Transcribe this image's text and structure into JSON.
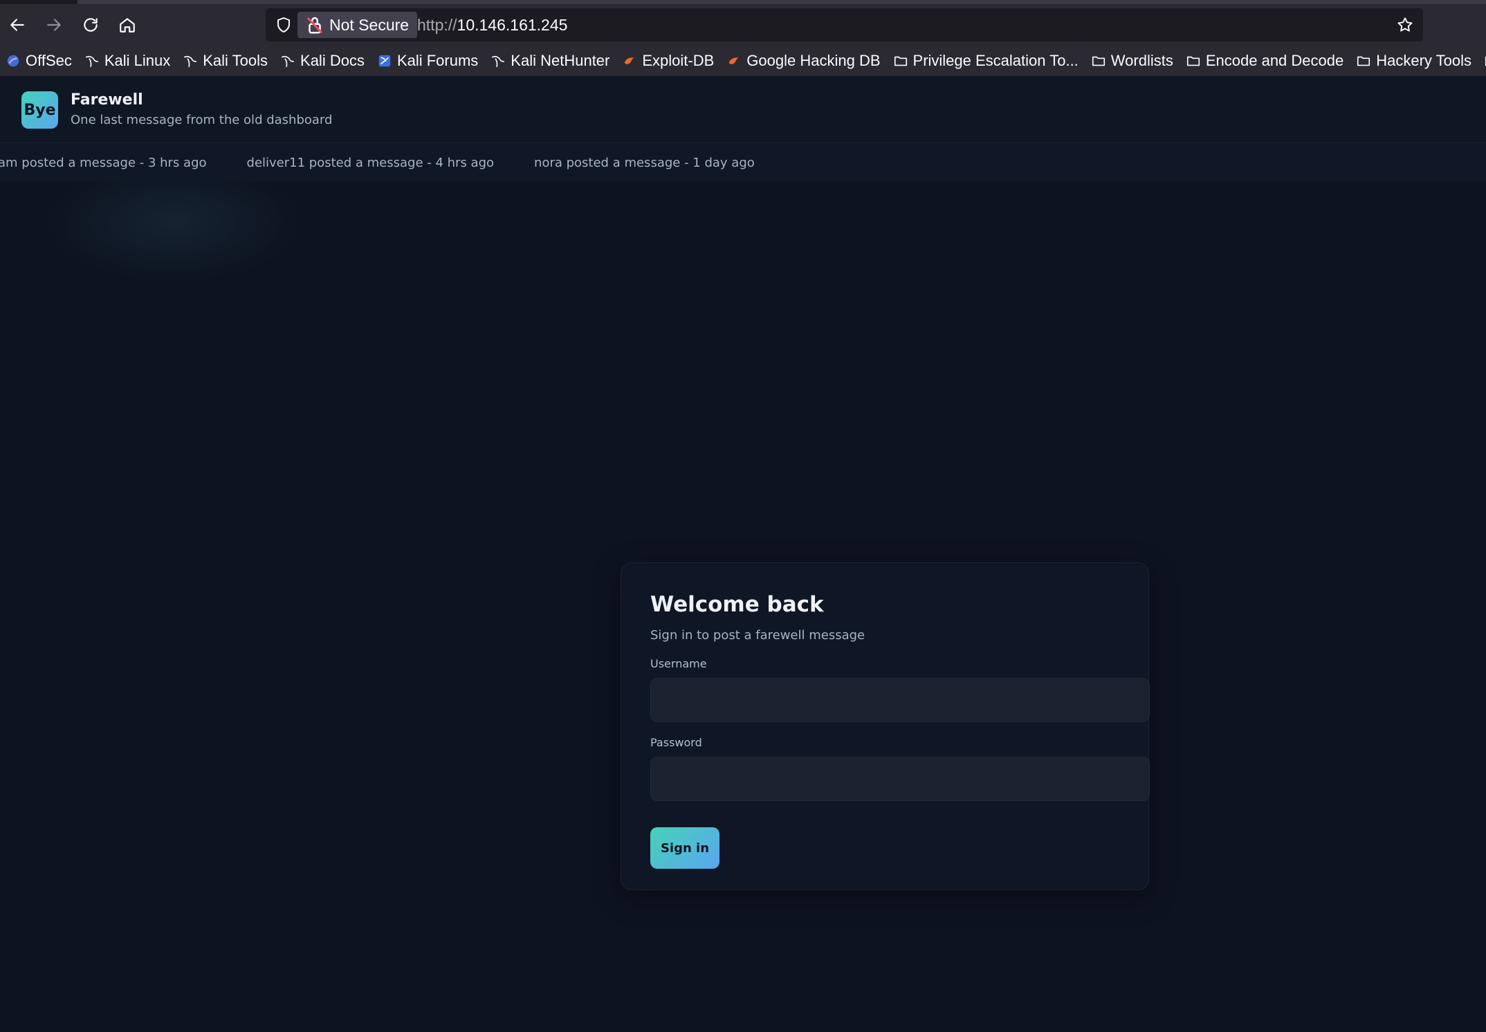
{
  "browser": {
    "security_label": "Not Secure",
    "url_protocol": "http://",
    "url_host": "10.146.161.245",
    "bookmarks": [
      {
        "label": "OffSec",
        "icon": "offsec-icon"
      },
      {
        "label": "Kali Linux",
        "icon": "kali-dragon-icon"
      },
      {
        "label": "Kali Tools",
        "icon": "kali-dragon-icon"
      },
      {
        "label": "Kali Docs",
        "icon": "kali-dragon-icon"
      },
      {
        "label": "Kali Forums",
        "icon": "kali-forums-icon"
      },
      {
        "label": "Kali NetHunter",
        "icon": "kali-dragon-icon"
      },
      {
        "label": "Exploit-DB",
        "icon": "exploit-db-icon"
      },
      {
        "label": "Google Hacking DB",
        "icon": "exploit-db-icon"
      },
      {
        "label": "Privilege Escalation To...",
        "icon": "folder-icon"
      },
      {
        "label": "Wordlists",
        "icon": "folder-icon"
      },
      {
        "label": "Encode and Decode",
        "icon": "folder-icon"
      },
      {
        "label": "Hackery Tools",
        "icon": "folder-icon"
      },
      {
        "label": "",
        "icon": "folder-icon"
      }
    ]
  },
  "site": {
    "logo_text": "Bye",
    "title": "Farewell",
    "subtitle": "One last message from the old dashboard"
  },
  "ticker": {
    "items": [
      "am posted a message - 3 hrs ago",
      "deliver11 posted a message - 4 hrs ago",
      "nora posted a message - 1 day ago"
    ]
  },
  "login": {
    "title": "Welcome back",
    "subtitle": "Sign in to post a farewell message",
    "username_label": "Username",
    "username_value": "",
    "password_label": "Password",
    "password_value": "",
    "submit_label": "Sign in"
  },
  "colors": {
    "accent_start": "#45d3b6",
    "accent_end": "#5aa6f0",
    "page_bg": "#0d1320"
  }
}
